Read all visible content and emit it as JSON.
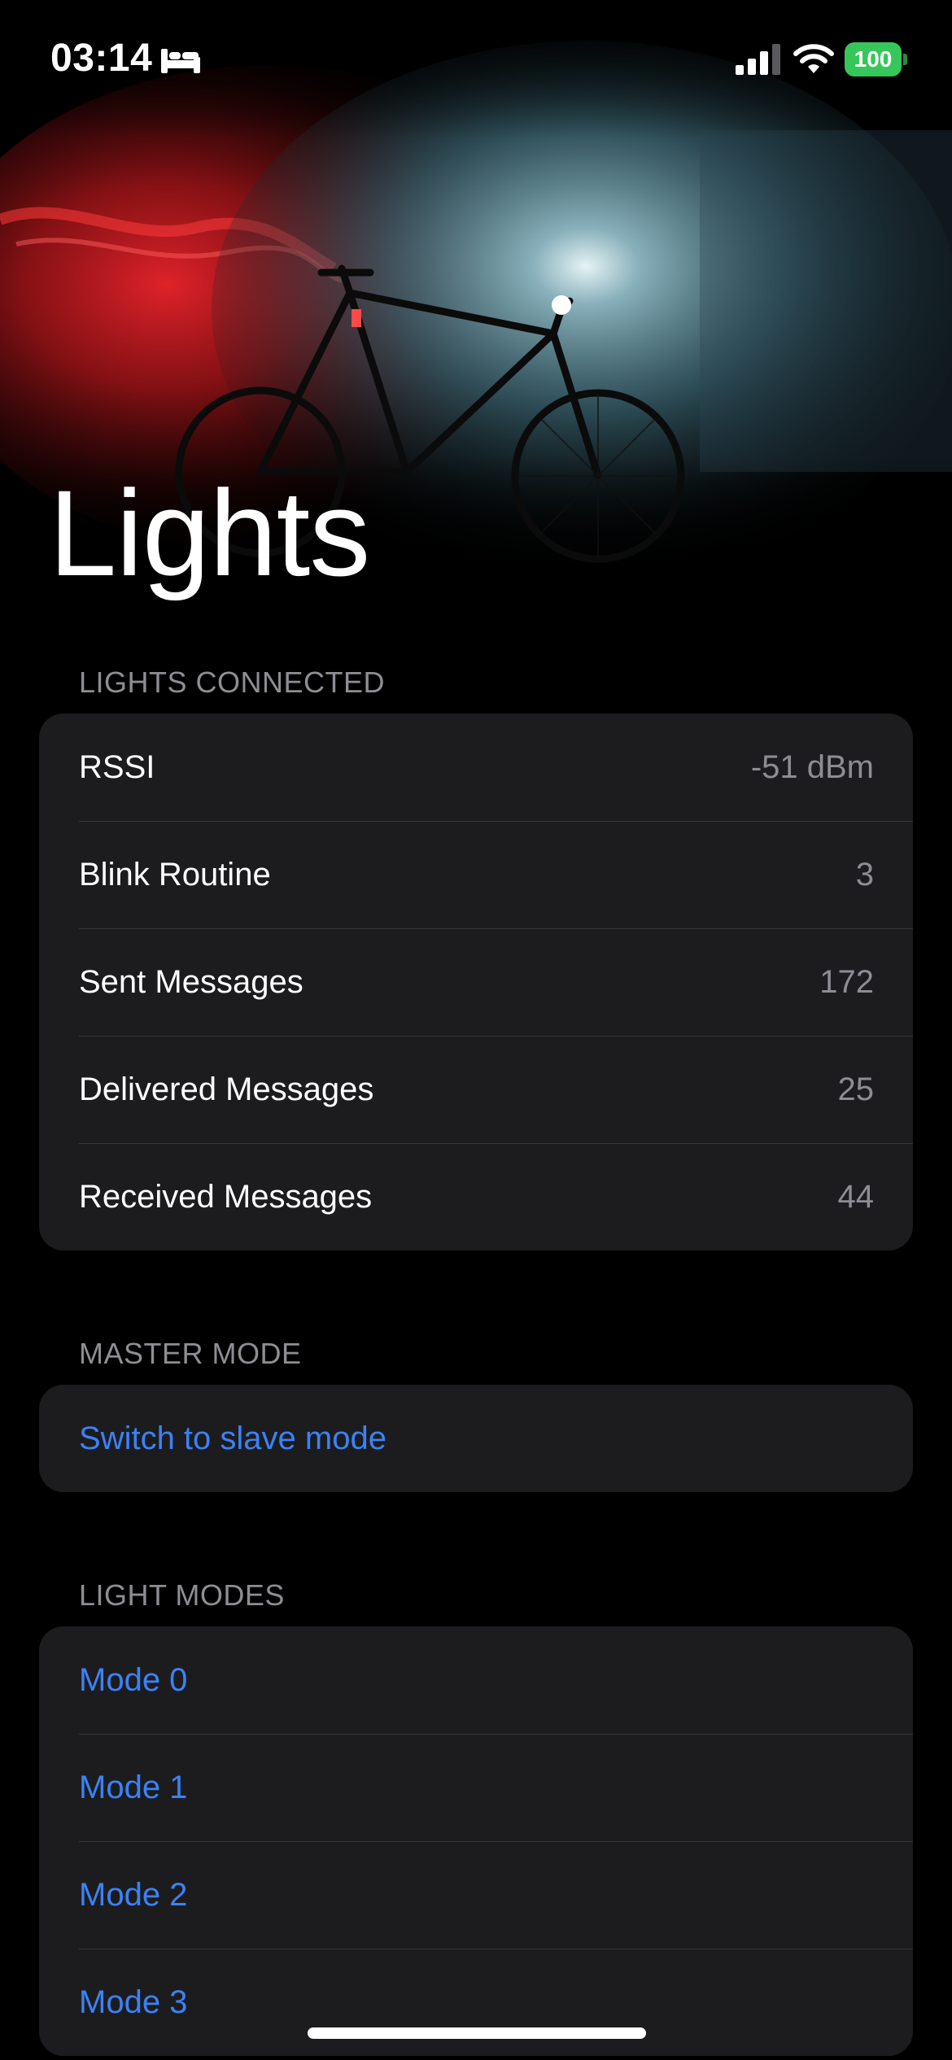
{
  "status": {
    "time": "03:14",
    "battery": "100"
  },
  "title": "Lights",
  "sections": {
    "connected": {
      "header": "LIGHTS CONNECTED",
      "rows": [
        {
          "label": "RSSI",
          "value": "-51 dBm"
        },
        {
          "label": "Blink Routine",
          "value": "3"
        },
        {
          "label": "Sent Messages",
          "value": "172"
        },
        {
          "label": "Delivered Messages",
          "value": "25"
        },
        {
          "label": "Received Messages",
          "value": "44"
        }
      ]
    },
    "master": {
      "header": "MASTER MODE",
      "action": "Switch to slave mode"
    },
    "modes": {
      "header": "LIGHT MODES",
      "items": [
        "Mode 0",
        "Mode 1",
        "Mode 2",
        "Mode 3"
      ]
    }
  },
  "colors": {
    "background": "#000000",
    "cell": "#1c1c1e",
    "separator": "#38383a",
    "secondary_text": "#8d8d93",
    "link": "#3b82f6",
    "battery": "#35c759"
  }
}
